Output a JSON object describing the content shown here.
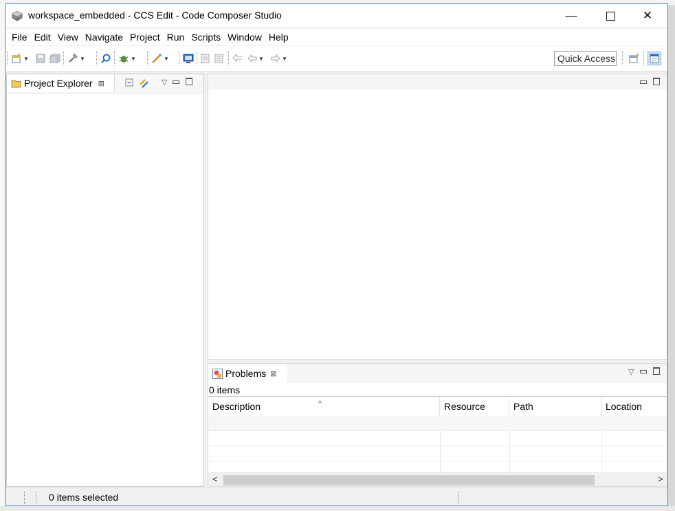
{
  "window": {
    "title": "workspace_embedded - CCS Edit - Code Composer Studio",
    "minimize_glyph": "—",
    "close_glyph": "✕"
  },
  "menu": [
    "File",
    "Edit",
    "View",
    "Navigate",
    "Project",
    "Run",
    "Scripts",
    "Window",
    "Help"
  ],
  "toolbar": {
    "quick_access": "Quick Access"
  },
  "explorer": {
    "tab_label": "Project Explorer",
    "close_glyph": "⊠"
  },
  "problems": {
    "tab_label": "Problems",
    "close_glyph": "⊠",
    "count": "0 items",
    "columns": [
      "Description",
      "Resource",
      "Path",
      "Location"
    ]
  },
  "status": {
    "text": "0 items selected"
  },
  "colors": {
    "window_border": "#4f87c6",
    "accent_blue": "#2b6cc4"
  }
}
